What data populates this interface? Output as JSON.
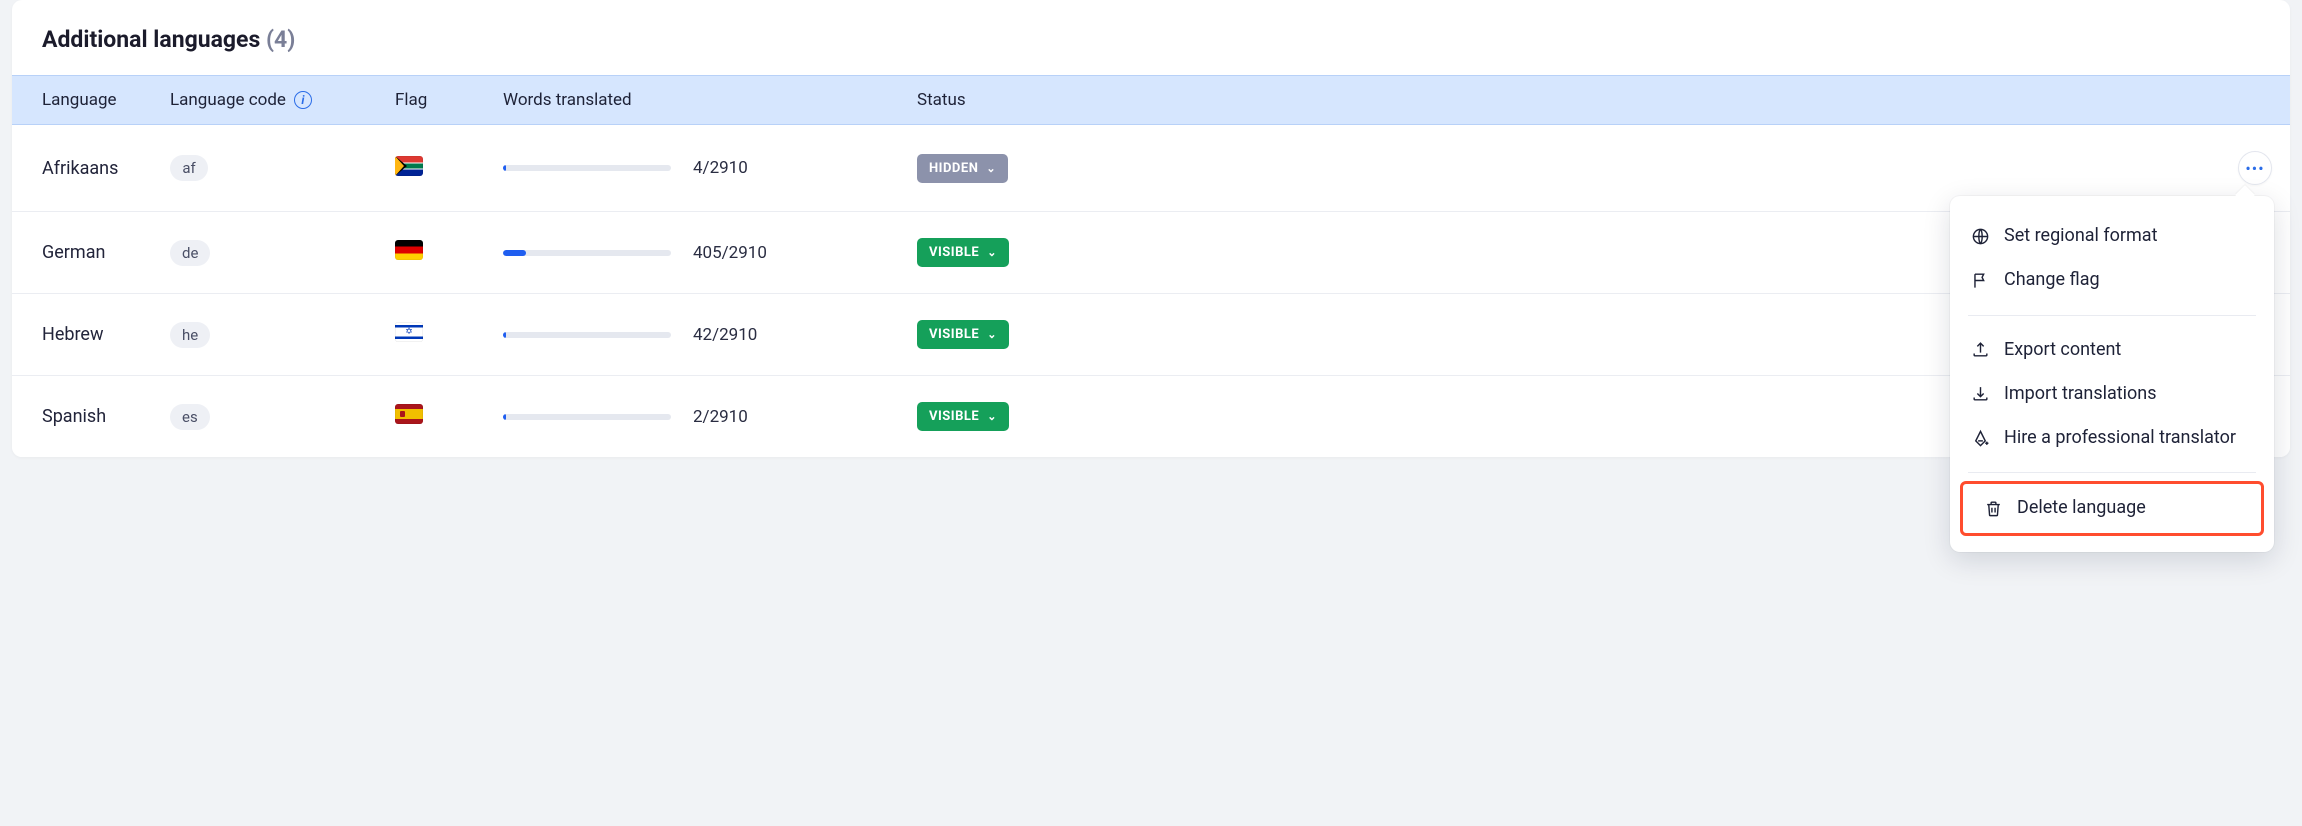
{
  "header": {
    "title_prefix": "Additional languages",
    "count_display": "(4)"
  },
  "columns": {
    "language": "Language",
    "code": "Language code",
    "flag": "Flag",
    "words": "Words translated",
    "status": "Status"
  },
  "status_labels": {
    "hidden": "HIDDEN",
    "visible": "VISIBLE"
  },
  "rows": [
    {
      "name": "Afrikaans",
      "code": "af",
      "flag": "za",
      "done": 4,
      "total": 2910,
      "status": "hidden"
    },
    {
      "name": "German",
      "code": "de",
      "flag": "de",
      "done": 405,
      "total": 2910,
      "status": "visible"
    },
    {
      "name": "Hebrew",
      "code": "he",
      "flag": "il",
      "done": 42,
      "total": 2910,
      "status": "visible"
    },
    {
      "name": "Spanish",
      "code": "es",
      "flag": "es",
      "done": 2,
      "total": 2910,
      "status": "visible"
    }
  ],
  "menu": {
    "set_regional": "Set regional format",
    "change_flag": "Change flag",
    "export": "Export content",
    "import": "Import translations",
    "hire": "Hire a professional translator",
    "delete": "Delete language"
  }
}
